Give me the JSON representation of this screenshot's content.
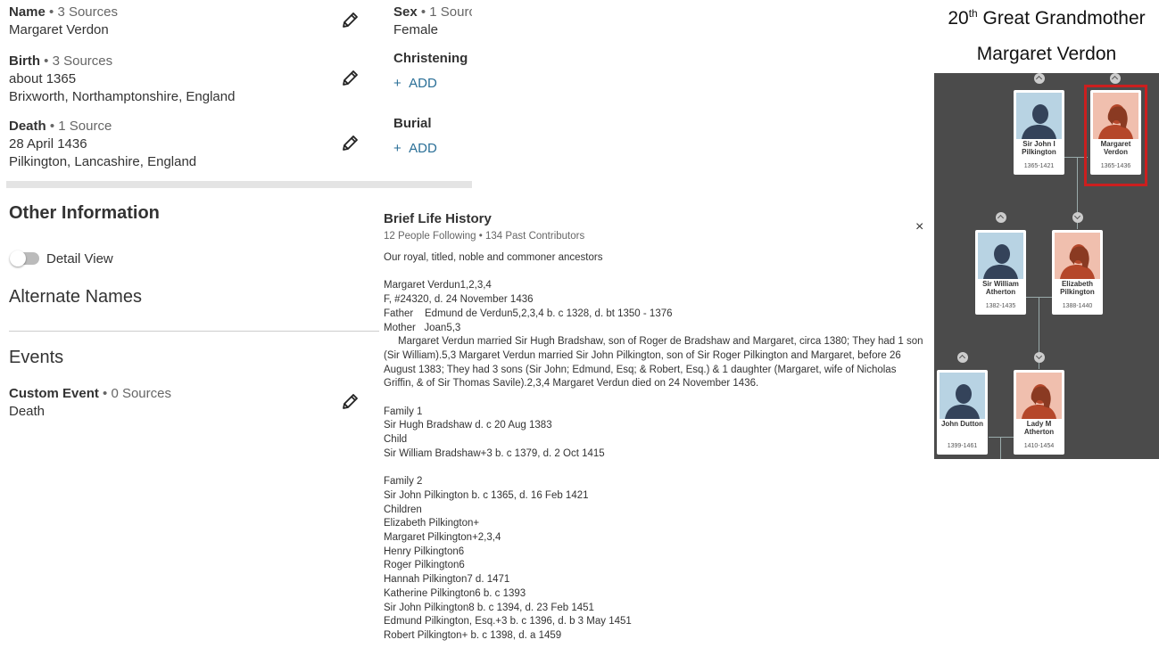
{
  "vitals": {
    "name": {
      "label": "Name",
      "sources": " • 3 Sources",
      "value": "Margaret Verdon"
    },
    "birth": {
      "label": "Birth",
      "sources": " • 3 Sources",
      "date": "about 1365",
      "place": "Brixworth, Northamptonshire, England"
    },
    "death": {
      "label": "Death",
      "sources": " • 1 Source",
      "date": "28 April 1436",
      "place": "Pilkington, Lancashire, England"
    },
    "sex": {
      "label": "Sex",
      "sources": " • 1 Sourc",
      "value": "Female"
    },
    "christening": {
      "label": "Christening",
      "add": "ADD"
    },
    "burial": {
      "label": "Burial",
      "add": "ADD"
    }
  },
  "other": {
    "title": "Other Information",
    "detail_view": "Detail View",
    "alternate_names": "Alternate Names",
    "events": "Events",
    "custom_event": {
      "label": "Custom Event",
      "sources": " • 0 Sources",
      "value": "Death"
    }
  },
  "blh": {
    "title": "Brief Life History",
    "subtitle": "12 People Following • 134 Past Contributors",
    "close": "×",
    "text": "Our royal, titled, noble and commoner ancestors\n\nMargaret Verdun1,2,3,4\nF, #24320, d. 24 November 1436\nFather    Edmund de Verdun5,2,3,4 b. c 1328, d. bt 1350 - 1376\nMother   Joan5,3\n     Margaret Verdun married Sir Hugh Bradshaw, son of Roger de Bradshaw and Margaret, circa 1380; They had 1 son (Sir William).5,3 Margaret Verdun married Sir John Pilkington, son of Sir Roger Pilkington and Margaret, before 26 August 1383; They had 3 sons (Sir John; Edmund, Esq; & Robert, Esq.) & 1 daughter (Margaret, wife of Nicholas Griffin, & of Sir Thomas Savile).2,3,4 Margaret Verdun died on 24 November 1436.\n\nFamily 1\nSir Hugh Bradshaw d. c 20 Aug 1383\nChild\nSir William Bradshaw+3 b. c 1379, d. 2 Oct 1415\n\nFamily 2\nSir John Pilkington b. c 1365, d. 16 Feb 1421\nChildren\nElizabeth Pilkington+\nMargaret Pilkington+2,3,4\nHenry Pilkington6\nRoger Pilkington6\nHannah Pilkington7 d. 1471\nKatherine Pilkington6 b. c 1393\nSir John Pilkington8 b. c 1394, d. 23 Feb 1451\nEdmund Pilkington, Esq.+3 b. c 1396, d. b 3 May 1451\nRobert Pilkington+ b. c 1398, d. a 1459"
  },
  "caption": {
    "generation_num": "20",
    "generation_sup": "th",
    "generation_rest": " Great Grandmother",
    "name": "Margaret Verdon"
  },
  "tree": {
    "people": [
      {
        "name": "Sir John I Pilkington",
        "dates": "1365-1421",
        "gender": "male"
      },
      {
        "name": "Margaret Verdon",
        "dates": "1365-1436",
        "gender": "female"
      },
      {
        "name": "Sir William Atherton",
        "dates": "1382-1435",
        "gender": "male"
      },
      {
        "name": "Elizabeth Pilkington",
        "dates": "1388-1440",
        "gender": "female"
      },
      {
        "name": "John Dutton",
        "dates": "1399-1461",
        "gender": "male"
      },
      {
        "name": "Lady M Atherton",
        "dates": "1410-1454",
        "gender": "female"
      }
    ],
    "colors": {
      "background": "#4b4b4b",
      "male_bg": "#b8d3e3",
      "male_fg": "#34435a",
      "female_bg": "#f0bfae",
      "female_fg": "#b5472a",
      "highlight": "#cc1f1f"
    }
  }
}
